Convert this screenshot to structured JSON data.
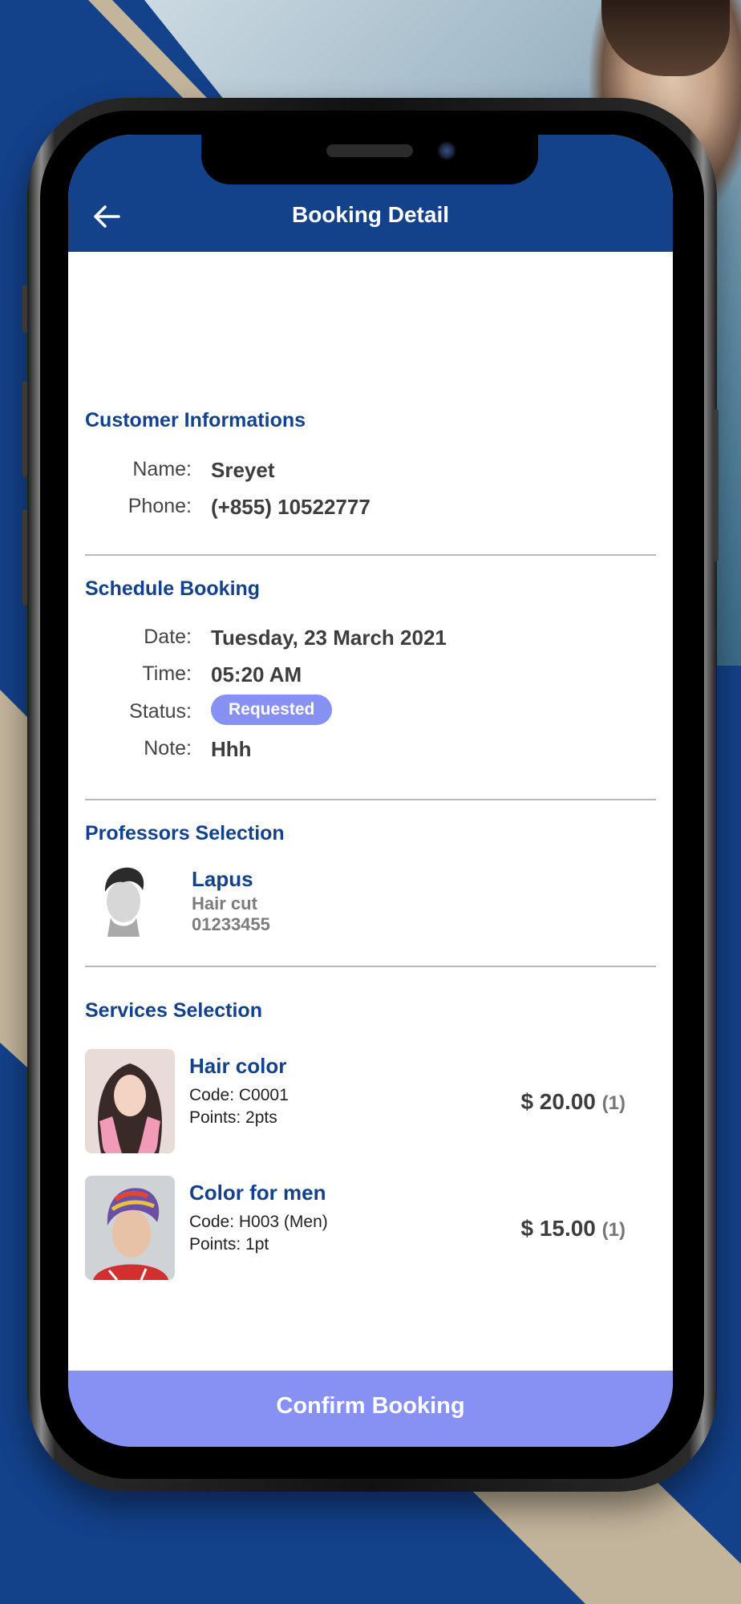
{
  "header": {
    "title": "Booking Detail",
    "back_icon": "arrow-left-icon"
  },
  "customer": {
    "section_title": "Customer Informations",
    "name_label": "Name:",
    "name_value": "Sreyet",
    "phone_label": "Phone:",
    "phone_value": "(+855) 10522777"
  },
  "schedule": {
    "section_title": "Schedule Booking",
    "date_label": "Date:",
    "date_value": "Tuesday, 23 March 2021",
    "time_label": "Time:",
    "time_value": "05:20 AM",
    "status_label": "Status:",
    "status_value": "Requested",
    "note_label": "Note:",
    "note_value": "Hhh"
  },
  "professor": {
    "section_title": "Professors Selection",
    "name": "Lapus",
    "role": "Hair cut",
    "phone": "01233455"
  },
  "services": {
    "section_title": "Services Selection",
    "items": [
      {
        "name": "Hair color",
        "code": "Code: C0001",
        "points": "Points: 2pts",
        "price": "$ 20.00",
        "qty": "(1)"
      },
      {
        "name": "Color for men",
        "code": "Code: H003 (Men)",
        "points": "Points: 1pt",
        "price": "$ 15.00",
        "qty": "(1)"
      }
    ]
  },
  "confirm_label": "Confirm Booking",
  "colors": {
    "brand_blue": "#13418a",
    "accent_purple": "#8691f3",
    "beige": "#c3b59b"
  }
}
